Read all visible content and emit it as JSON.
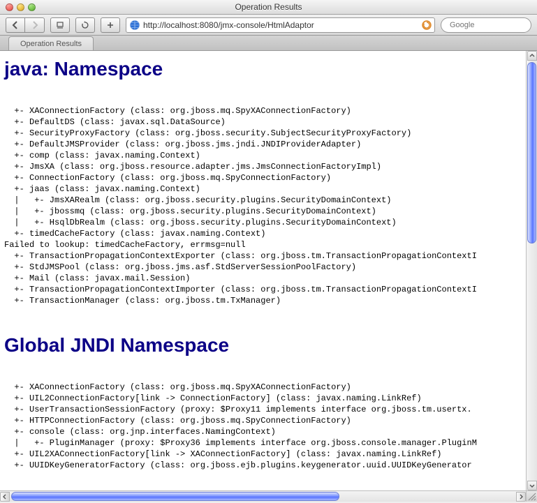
{
  "window": {
    "title": "Operation Results"
  },
  "toolbar": {
    "url": "http://localhost:8080/jmx-console/HtmlAdaptor",
    "search_placeholder": "Google"
  },
  "tab": {
    "label": "Operation Results"
  },
  "page": {
    "heading_java": "java: Namespace",
    "heading_global": "Global JNDI Namespace",
    "lines_java": [
      "+- XAConnectionFactory (class: org.jboss.mq.SpyXAConnectionFactory)",
      "+- DefaultDS (class: javax.sql.DataSource)",
      "+- SecurityProxyFactory (class: org.jboss.security.SubjectSecurityProxyFactory)",
      "+- DefaultJMSProvider (class: org.jboss.jms.jndi.JNDIProviderAdapter)",
      "+- comp (class: javax.naming.Context)",
      "+- JmsXA (class: org.jboss.resource.adapter.jms.JmsConnectionFactoryImpl)",
      "+- ConnectionFactory (class: org.jboss.mq.SpyConnectionFactory)",
      "+- jaas (class: javax.naming.Context)",
      "|   +- JmsXARealm (class: org.jboss.security.plugins.SecurityDomainContext)",
      "|   +- jbossmq (class: org.jboss.security.plugins.SecurityDomainContext)",
      "|   +- HsqlDbRealm (class: org.jboss.security.plugins.SecurityDomainContext)",
      "+- timedCacheFactory (class: javax.naming.Context)",
      "Failed to lookup: timedCacheFactory, errmsg=null",
      "+- TransactionPropagationContextExporter (class: org.jboss.tm.TransactionPropagationContextI",
      "+- StdJMSPool (class: org.jboss.jms.asf.StdServerSessionPoolFactory)",
      "+- Mail (class: javax.mail.Session)",
      "+- TransactionPropagationContextImporter (class: org.jboss.tm.TransactionPropagationContextI",
      "+- TransactionManager (class: org.jboss.tm.TxManager)"
    ],
    "lines_global": [
      "+- XAConnectionFactory (class: org.jboss.mq.SpyXAConnectionFactory)",
      "+- UIL2ConnectionFactory[link -> ConnectionFactory] (class: javax.naming.LinkRef)",
      "+- UserTransactionSessionFactory (proxy: $Proxy11 implements interface org.jboss.tm.usertx.",
      "+- HTTPConnectionFactory (class: org.jboss.mq.SpyConnectionFactory)",
      "+- console (class: org.jnp.interfaces.NamingContext)",
      "|   +- PluginManager (proxy: $Proxy36 implements interface org.jboss.console.manager.PluginM",
      "+- UIL2XAConnectionFactory[link -> XAConnectionFactory] (class: javax.naming.LinkRef)",
      "+- UUIDKeyGeneratorFactory (class: org.jboss.ejb.plugins.keygenerator.uuid.UUIDKeyGenerator"
    ]
  }
}
